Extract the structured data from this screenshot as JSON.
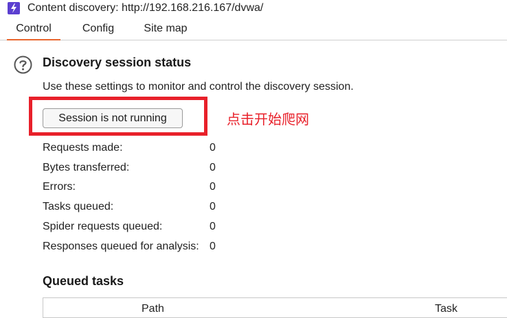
{
  "window": {
    "title": "Content discovery: http://192.168.216.167/dvwa/",
    "app_icon": "lightning-icon",
    "accent_color": "#5b3fd0"
  },
  "tabs": [
    {
      "label": "Control",
      "active": true
    },
    {
      "label": "Config",
      "active": false
    },
    {
      "label": "Site map",
      "active": false
    }
  ],
  "status_section": {
    "help_icon": "question-circle-icon",
    "title": "Discovery session status",
    "description": "Use these settings to monitor and control the discovery session.",
    "session_button_label": "Session is not running",
    "annotation_text": "点击开始爬网",
    "annotation_color": "#e8202a"
  },
  "stats": [
    {
      "label": "Requests made:",
      "value": "0"
    },
    {
      "label": "Bytes transferred:",
      "value": "0"
    },
    {
      "label": "Errors:",
      "value": "0"
    },
    {
      "label": "Tasks queued:",
      "value": "0"
    },
    {
      "label": "Spider requests queued:",
      "value": "0"
    },
    {
      "label": "Responses queued for analysis:",
      "value": "0"
    }
  ],
  "queued_tasks": {
    "title": "Queued tasks",
    "columns": [
      "Path",
      "Task"
    ]
  }
}
